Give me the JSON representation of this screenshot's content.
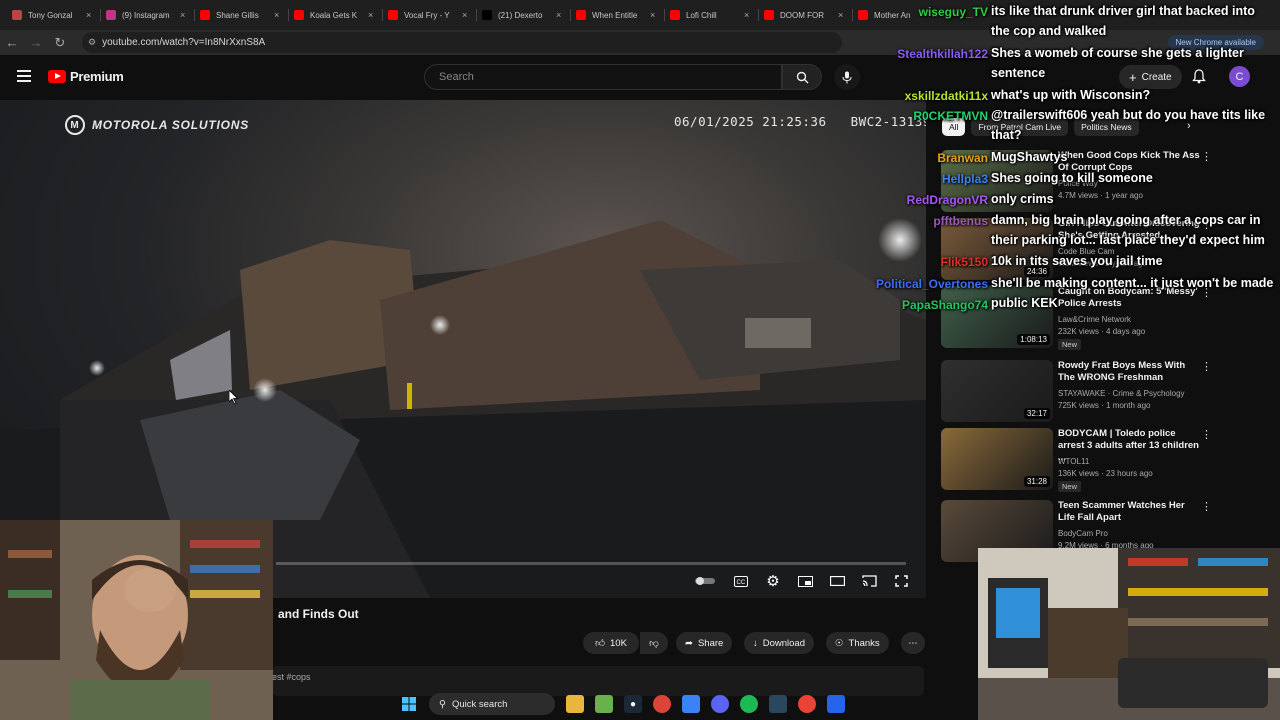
{
  "browser": {
    "tabs": [
      {
        "title": "Tony Gonzal",
        "icon": "tab-favicon",
        "color": "#b44"
      },
      {
        "title": "(9) Instagram",
        "icon": "instagram-icon",
        "color": "#c13584"
      },
      {
        "title": "Shane Gillis",
        "icon": "youtube-icon",
        "color": "#ff0000"
      },
      {
        "title": "Koala Gets K",
        "icon": "youtube-icon",
        "color": "#ff0000"
      },
      {
        "title": "Vocal Fry - Y",
        "icon": "youtube-icon",
        "color": "#ff0000"
      },
      {
        "title": "(21) Dexerto",
        "icon": "x-icon",
        "color": "#000000"
      },
      {
        "title": "When Entitle",
        "icon": "youtube-icon",
        "color": "#ff0000"
      },
      {
        "title": "Lofi Chill",
        "icon": "youtube-icon",
        "color": "#ff0000"
      },
      {
        "title": "DOOM FOR",
        "icon": "youtube-icon",
        "color": "#ff0000"
      },
      {
        "title": "Mother An",
        "icon": "youtube-icon",
        "color": "#ff0000"
      }
    ],
    "url": "youtube.com/watch?v=In8NrXxnS8A",
    "new_chrome": "New Chrome available"
  },
  "header": {
    "logo_text": "Premium",
    "search_placeholder": "Search",
    "create_label": "Create",
    "avatar_letter": "C"
  },
  "video": {
    "brand": "MOTOROLA SOLUTIONS",
    "timestamp": "06/01/2025 21:25:36",
    "device_id": "BWC2-131391",
    "progress": 0.0,
    "title_fragment": "and Finds Out",
    "desc_fragment": "est #cops"
  },
  "actions": {
    "like_count": "10K",
    "share": "Share",
    "download": "Download",
    "thanks": "Thanks"
  },
  "chips": [
    "All",
    "From Patrol Cam Live",
    "Politics News"
  ],
  "recommendations": [
    {
      "title": "When Good Cops Kick The Ass Of Corrupt Cops",
      "channel": "Police Way",
      "meta": "4.7M views · 1 year ago",
      "duration": "",
      "badge": ""
    },
    {
      "title": "Girl Flips Out After Discovering She's Getting Arrested",
      "channel": "Code Blue Cam",
      "meta": "8.1M views · 2 years ago",
      "duration": "24:36",
      "badge": ""
    },
    {
      "title": "Caught on Bodycam: 5 'Messy' Police Arrests",
      "channel": "Law&Crime Network",
      "meta": "232K views · 4 days ago",
      "duration": "1:08:13",
      "badge": "New"
    },
    {
      "title": "Rowdy Frat Boys Mess With The WRONG Freshman",
      "channel": "STAYAWAKE · Crime & Psychology",
      "meta": "725K views · 1 month ago",
      "duration": "32:17",
      "badge": ""
    },
    {
      "title": "BODYCAM | Toledo police arrest 3 adults after 13 children ...",
      "channel": "WTOL11",
      "meta": "136K views · 23 hours ago",
      "duration": "31:28",
      "badge": "New"
    },
    {
      "title": "Teen Scammer Watches Her Life Fall Apart",
      "channel": "BodyCam Pro",
      "meta": "9.2M views · 6 months ago",
      "duration": "",
      "badge": ""
    }
  ],
  "chat": {
    "messages": [
      {
        "user": "wiseguy_TV",
        "color": "#2ecc40",
        "text": "its like that drunk driver girl that backed into",
        "text2": "the cop and walked"
      },
      {
        "user": "Stealthkillah122",
        "color": "#8a5cf6",
        "text": "Shes a womeb of course she gets a lighter",
        "text2": "sentence"
      },
      {
        "user": "xskillzdatki11x",
        "color": "#b8e62e",
        "text": "what's up with Wisconsin?",
        "text2": ""
      },
      {
        "user": "R0CKETMVN",
        "color": "#22d36b",
        "text": "@trailerswift606 yeah but do you have tits like",
        "text2": "that?"
      },
      {
        "user": "Branwan",
        "color": "#e8a020",
        "text": "MugShawtys",
        "text2": ""
      },
      {
        "user": "Hellpla3",
        "color": "#3b82f6",
        "text": "Shes going to kill someone",
        "text2": ""
      },
      {
        "user": "RedDragonVR",
        "color": "#a855f7",
        "text": "only crims",
        "text2": ""
      },
      {
        "user": "pfftbenus",
        "color": "#9b59b6",
        "text": "damn, big brain play going after a cops car in",
        "text2": "their parking lot... last place they'd expect him"
      },
      {
        "user": "Flik5150",
        "color": "#e0302b",
        "text": "10k in tits saves you jail time",
        "text2": ""
      },
      {
        "user": "Political_Overtones",
        "color": "#3b6ff5",
        "text": "she'll be making content... it just won't be made",
        "text2": "public KEK"
      },
      {
        "user": "PapaShango74",
        "color": "#22c55e",
        "text": "",
        "text2": ""
      }
    ]
  },
  "taskbar": {
    "search_label": "Quick search"
  }
}
